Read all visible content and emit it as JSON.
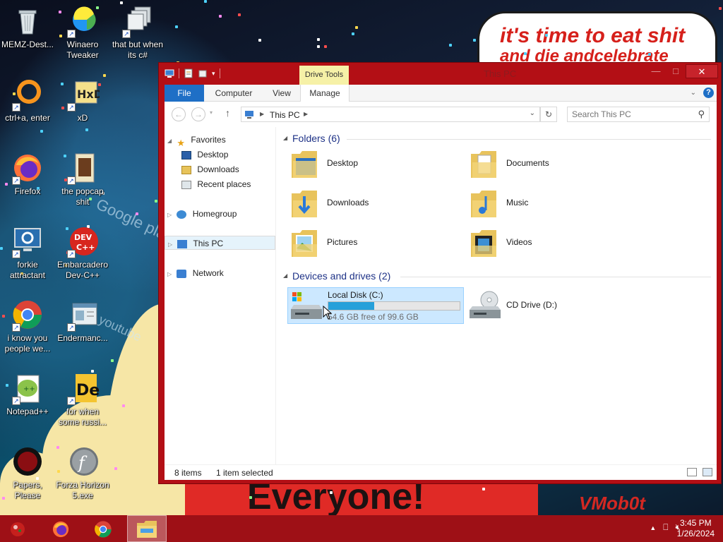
{
  "wallpaper": {
    "speech_text": "it's time to eat shit",
    "speech_text_2": "and die andcelebrate",
    "banner_text": "Everyone!",
    "corner_text": "VMob0t",
    "billboard_text": "Google play",
    "billboard_text_2": "youtube"
  },
  "desktop_icons": [
    {
      "label": "MEMZ-Dest...",
      "icon": "recycle-bin-icon"
    },
    {
      "label": "Winaero Tweaker",
      "icon": "winaero-icon"
    },
    {
      "label": "that but when its c#",
      "icon": "copies-icon"
    },
    {
      "label": "ctrl+a, enter",
      "icon": "orange-ring-icon"
    },
    {
      "label": "xD",
      "icon": "hxd-icon"
    },
    {
      "label": "Firefox",
      "icon": "firefox-icon"
    },
    {
      "label": "the popcap shit",
      "icon": "popcap-icon"
    },
    {
      "label": "forkie attractant",
      "icon": "settings-monitor-icon"
    },
    {
      "label": "Embarcadero Dev-C++",
      "icon": "devcpp-icon"
    },
    {
      "label": "i know you people we...",
      "icon": "chrome-icon"
    },
    {
      "label": "Endermanc...",
      "icon": "window-app-icon"
    },
    {
      "label": "Notepad++",
      "icon": "notepadpp-icon"
    },
    {
      "label": "for when some russi...",
      "icon": "de-icon"
    },
    {
      "label": "Papers, Please",
      "icon": "papers-please-icon"
    },
    {
      "label": "Forza Horizon 5.exe",
      "icon": "flash-icon"
    }
  ],
  "window": {
    "title": "This PC",
    "context_tab": "Drive Tools",
    "close_glyph": "✕",
    "min_glyph": "—",
    "max_glyph": "□"
  },
  "ribbon": {
    "tabs": [
      "File",
      "Computer",
      "View",
      "Manage"
    ],
    "help": "?"
  },
  "nav": {
    "address": "This PC",
    "search_placeholder": "Search This PC"
  },
  "navpane": {
    "favorites": "Favorites",
    "desktop": "Desktop",
    "downloads": "Downloads",
    "recent": "Recent places",
    "homegroup": "Homegroup",
    "thispc": "This PC",
    "network": "Network"
  },
  "groups": {
    "folders_header": "Folders (6)",
    "devices_header": "Devices and drives (2)"
  },
  "folders": [
    {
      "name": "Desktop",
      "icon": "desktop-folder-icon"
    },
    {
      "name": "Documents",
      "icon": "documents-folder-icon"
    },
    {
      "name": "Downloads",
      "icon": "downloads-folder-icon"
    },
    {
      "name": "Music",
      "icon": "music-folder-icon"
    },
    {
      "name": "Pictures",
      "icon": "pictures-folder-icon"
    },
    {
      "name": "Videos",
      "icon": "videos-folder-icon"
    }
  ],
  "drives": [
    {
      "name": "Local Disk (C:)",
      "free_text": "54.6 GB free of 99.6 GB",
      "used_fraction": 0.35,
      "selected": true
    },
    {
      "name": "CD Drive (D:)"
    }
  ],
  "status": {
    "items": "8 items",
    "selected": "1 item selected"
  },
  "taskbar": {
    "time": "3:45 PM",
    "date": "1/26/2024"
  },
  "colors": {
    "window_frame": "#b30f15",
    "taskbar": "#9e1016",
    "accent": "#1e6fc6",
    "selection": "#cce8ff",
    "drive_bar": "#26a0da"
  }
}
